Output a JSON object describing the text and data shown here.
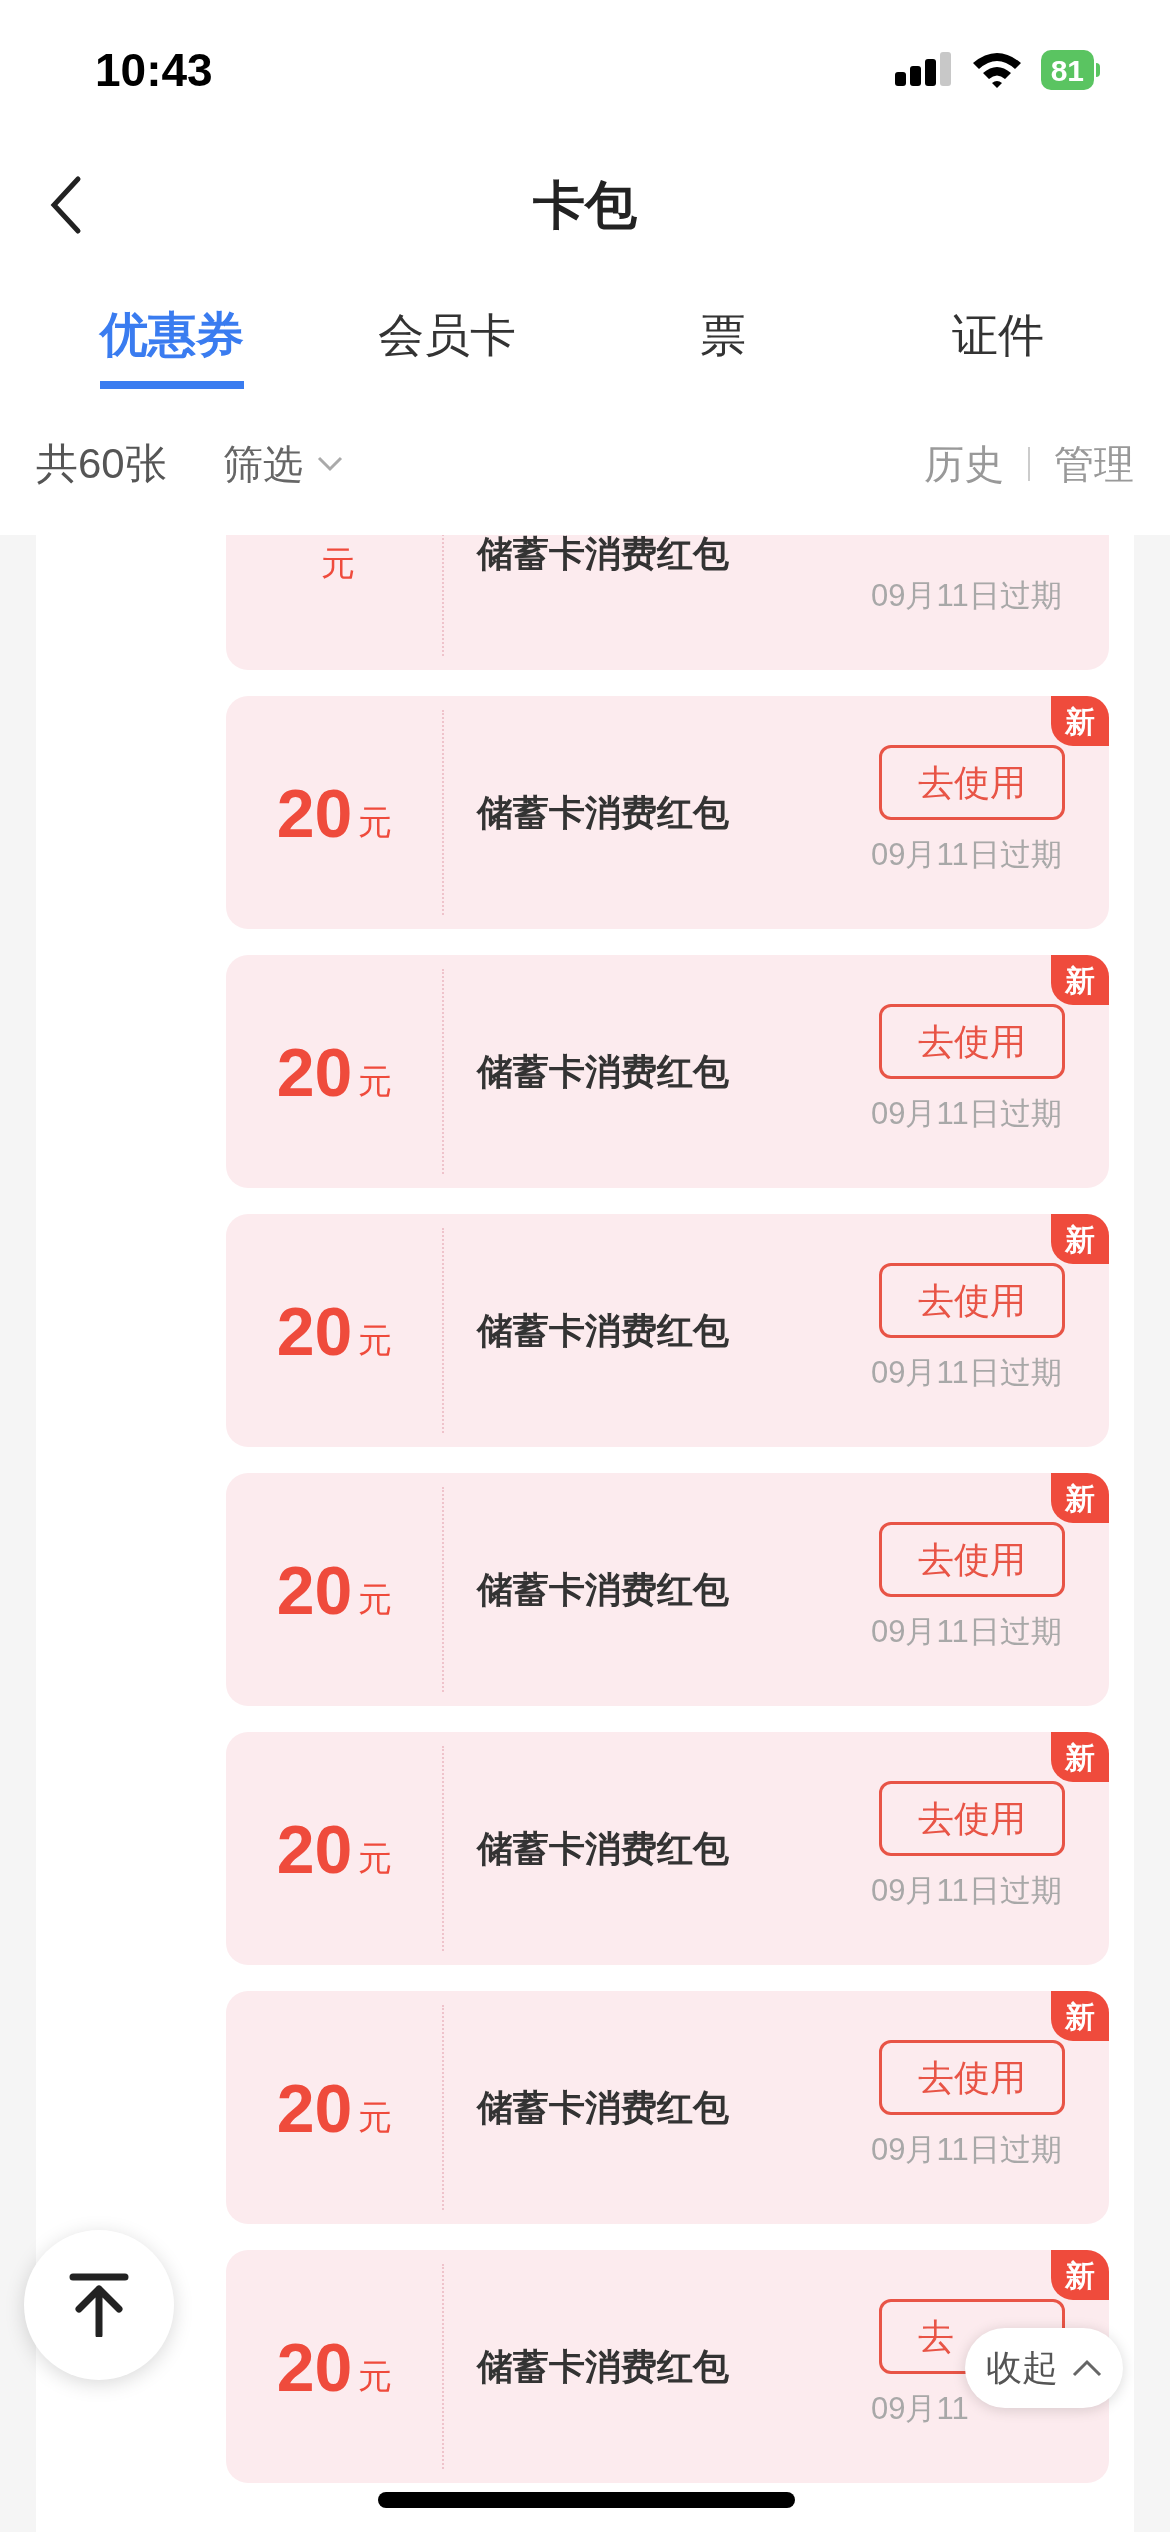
{
  "status_bar": {
    "time": "10:43",
    "battery": "81"
  },
  "nav": {
    "title": "卡包"
  },
  "tabs": [
    {
      "label": "优惠券",
      "selected": true
    },
    {
      "label": "会员卡",
      "selected": false
    },
    {
      "label": "票",
      "selected": false
    },
    {
      "label": "证件",
      "selected": false
    }
  ],
  "filter_bar": {
    "count": "共60张",
    "filter": "筛选",
    "history": "历史",
    "manage": "管理"
  },
  "coupons": [
    {
      "unit": "元",
      "name": "储蓄卡消费红包",
      "expiry": "09月11日过期"
    },
    {
      "amount": "20",
      "unit": "元",
      "name": "储蓄卡消费红包",
      "button": "去使用",
      "expiry": "09月11日过期",
      "badge": "新"
    },
    {
      "amount": "20",
      "unit": "元",
      "name": "储蓄卡消费红包",
      "button": "去使用",
      "expiry": "09月11日过期",
      "badge": "新"
    },
    {
      "amount": "20",
      "unit": "元",
      "name": "储蓄卡消费红包",
      "button": "去使用",
      "expiry": "09月11日过期",
      "badge": "新"
    },
    {
      "amount": "20",
      "unit": "元",
      "name": "储蓄卡消费红包",
      "button": "去使用",
      "expiry": "09月11日过期",
      "badge": "新"
    },
    {
      "amount": "20",
      "unit": "元",
      "name": "储蓄卡消费红包",
      "button": "去使用",
      "expiry": "09月11日过期",
      "badge": "新"
    },
    {
      "amount": "20",
      "unit": "元",
      "name": "储蓄卡消费红包",
      "button": "去使用",
      "expiry": "09月11日过期",
      "badge": "新"
    },
    {
      "amount": "20",
      "unit": "元",
      "name": "储蓄卡消费红包",
      "button": "去",
      "expiry": "09月11",
      "badge": "新"
    }
  ],
  "collapse": {
    "label": "收起"
  }
}
